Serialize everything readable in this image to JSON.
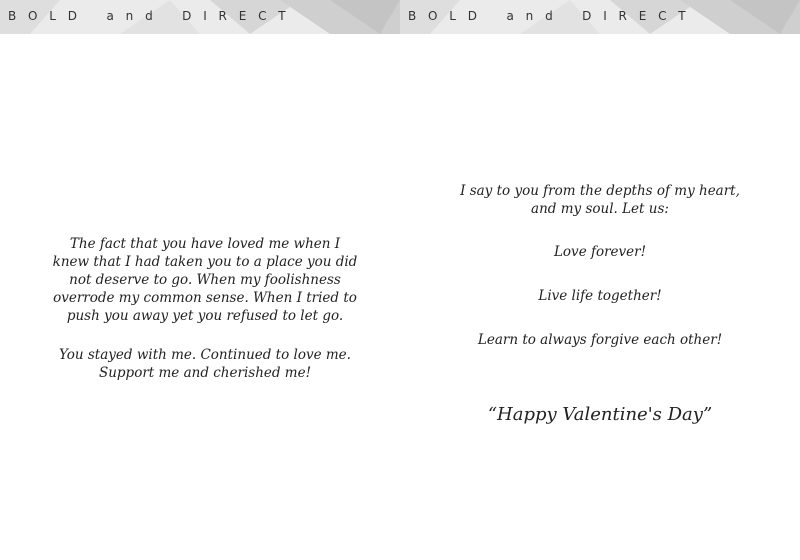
{
  "banner": {
    "left_text": "B O L D   a n d   D I R E C T",
    "right_text": "B O L D   a n d   D I R E C T"
  },
  "left_page": {
    "paragraph_1": "The fact that you have loved me when I knew that I had taken you to a place you did not deserve to go.  When my foolishness overrode my common sense.  When I tried to push you away yet you refused to let go.",
    "paragraph_2": "You stayed with me. Continued to love me. Support me and cherished me!"
  },
  "right_page": {
    "intro": "I say to you from the depths of my heart, and my soul.  Let us:",
    "line_1": "Love forever!",
    "line_2": "Live life together!",
    "line_3": "Learn to always forgive each other!",
    "closing": "“Happy Valentine's Day”"
  },
  "colors": {
    "banner_bg": "#ebebeb",
    "banner_shape_dark": "#c9c9c9",
    "banner_shape_mid": "#d9d9d9",
    "text": "#222222"
  }
}
